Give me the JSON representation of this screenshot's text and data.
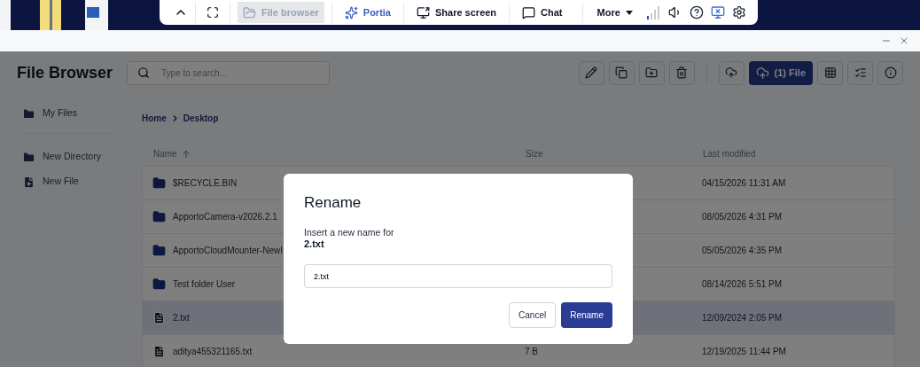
{
  "toolbar": {
    "items": [
      {
        "kind": "collapse"
      },
      {
        "kind": "fullscreen"
      },
      {
        "kind": "file_browser",
        "label": "File browser",
        "selected": true
      },
      {
        "kind": "assistant",
        "label": "Portia",
        "selected": false
      },
      {
        "kind": "share_screen",
        "label": "Share screen",
        "selected": false
      },
      {
        "kind": "chat",
        "label": "Chat",
        "selected": false
      },
      {
        "kind": "menu",
        "label": "More"
      }
    ]
  },
  "app": {
    "title": "File Browser",
    "search": {
      "placeholder": "Type to search..."
    },
    "upload_status": "(1) File",
    "sidebar": {
      "items": [
        {
          "kind": "nav",
          "label": "My Files",
          "selected": false
        },
        {
          "kind": "new_directory",
          "label": "New Directory"
        },
        {
          "kind": "new_file",
          "label": "New File"
        }
      ]
    },
    "breadcrumb": [
      "Home",
      "Desktop"
    ],
    "table": {
      "columns": [
        "Name",
        "Size",
        "Last modified"
      ],
      "rows": [
        {
          "kind": "folder",
          "name": "$RECYCLE.BIN",
          "modified": "04/15/2026 11:31 AM",
          "selected": false
        },
        {
          "kind": "folder",
          "name": "ApportoCamera-v2026.2.1",
          "modified": "08/05/2026 4:31 PM",
          "selected": false
        },
        {
          "kind": "folder",
          "name": "ApportoCloudMounter-NewI",
          "modified": "05/05/2026 4:35 PM",
          "selected": false
        },
        {
          "kind": "folder",
          "name": "Test folder User",
          "modified": "08/14/2026 5:51 PM",
          "selected": false
        },
        {
          "kind": "file",
          "name": "2.txt",
          "modified": "12/09/2024 2:05 PM",
          "selected": true
        },
        {
          "kind": "file",
          "name": "aditya455321165.txt",
          "size": "7 B",
          "modified": "12/19/2025 11:44 PM",
          "selected": false
        }
      ]
    }
  },
  "dialog": {
    "title": "Rename",
    "prompt": "Insert a new name for",
    "target": "2.txt",
    "value": "2.txt",
    "buttons": [
      {
        "label": "Cancel",
        "primary": false
      },
      {
        "label": "Rename",
        "primary": true
      }
    ]
  }
}
